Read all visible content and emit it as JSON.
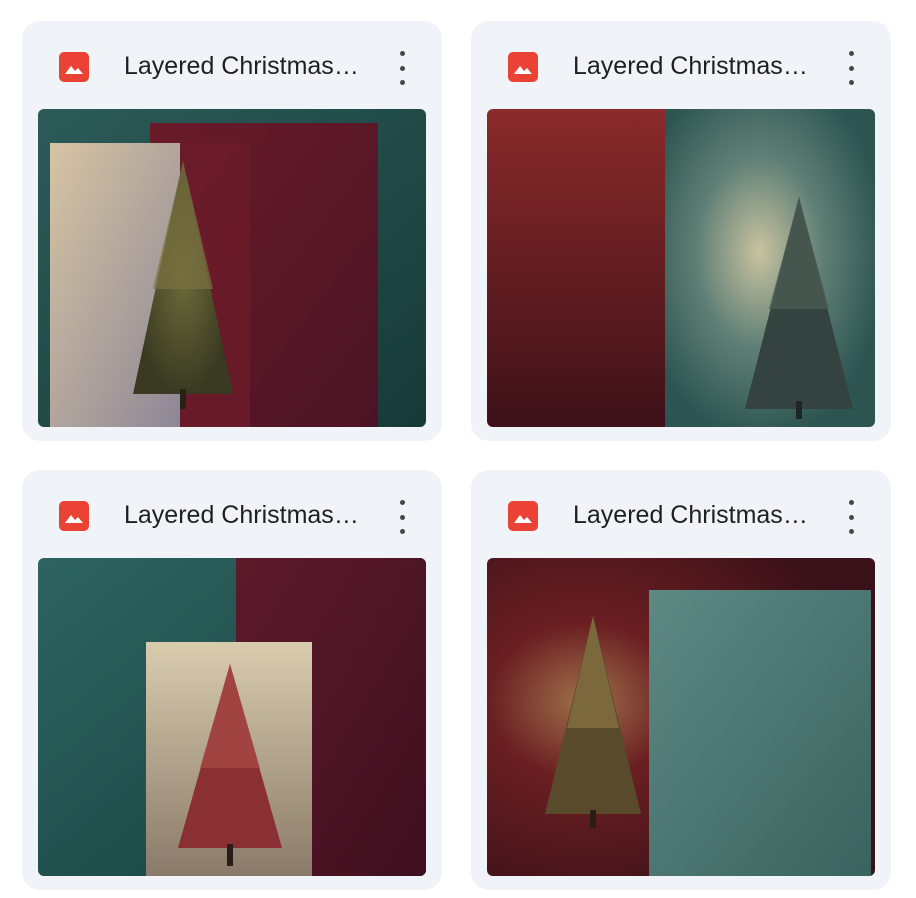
{
  "files": [
    {
      "title": "Layered Christmas Tree Backgrounds",
      "icon": "image-icon",
      "menu_icon": "more-vert-icon"
    },
    {
      "title": "Layered Christmas Tree Backgrounds",
      "icon": "image-icon",
      "menu_icon": "more-vert-icon"
    },
    {
      "title": "Layered Christmas Tree Backgrounds",
      "icon": "image-icon",
      "menu_icon": "more-vert-icon"
    },
    {
      "title": "Layered Christmas Tree Backgrounds",
      "icon": "image-icon",
      "menu_icon": "more-vert-icon"
    }
  ],
  "colors": {
    "card_bg": "#f0f4f9",
    "icon_red": "#ea4335",
    "teal": "#1f4d4a",
    "burgundy": "#5a1622",
    "cream": "#d9c7a6"
  }
}
